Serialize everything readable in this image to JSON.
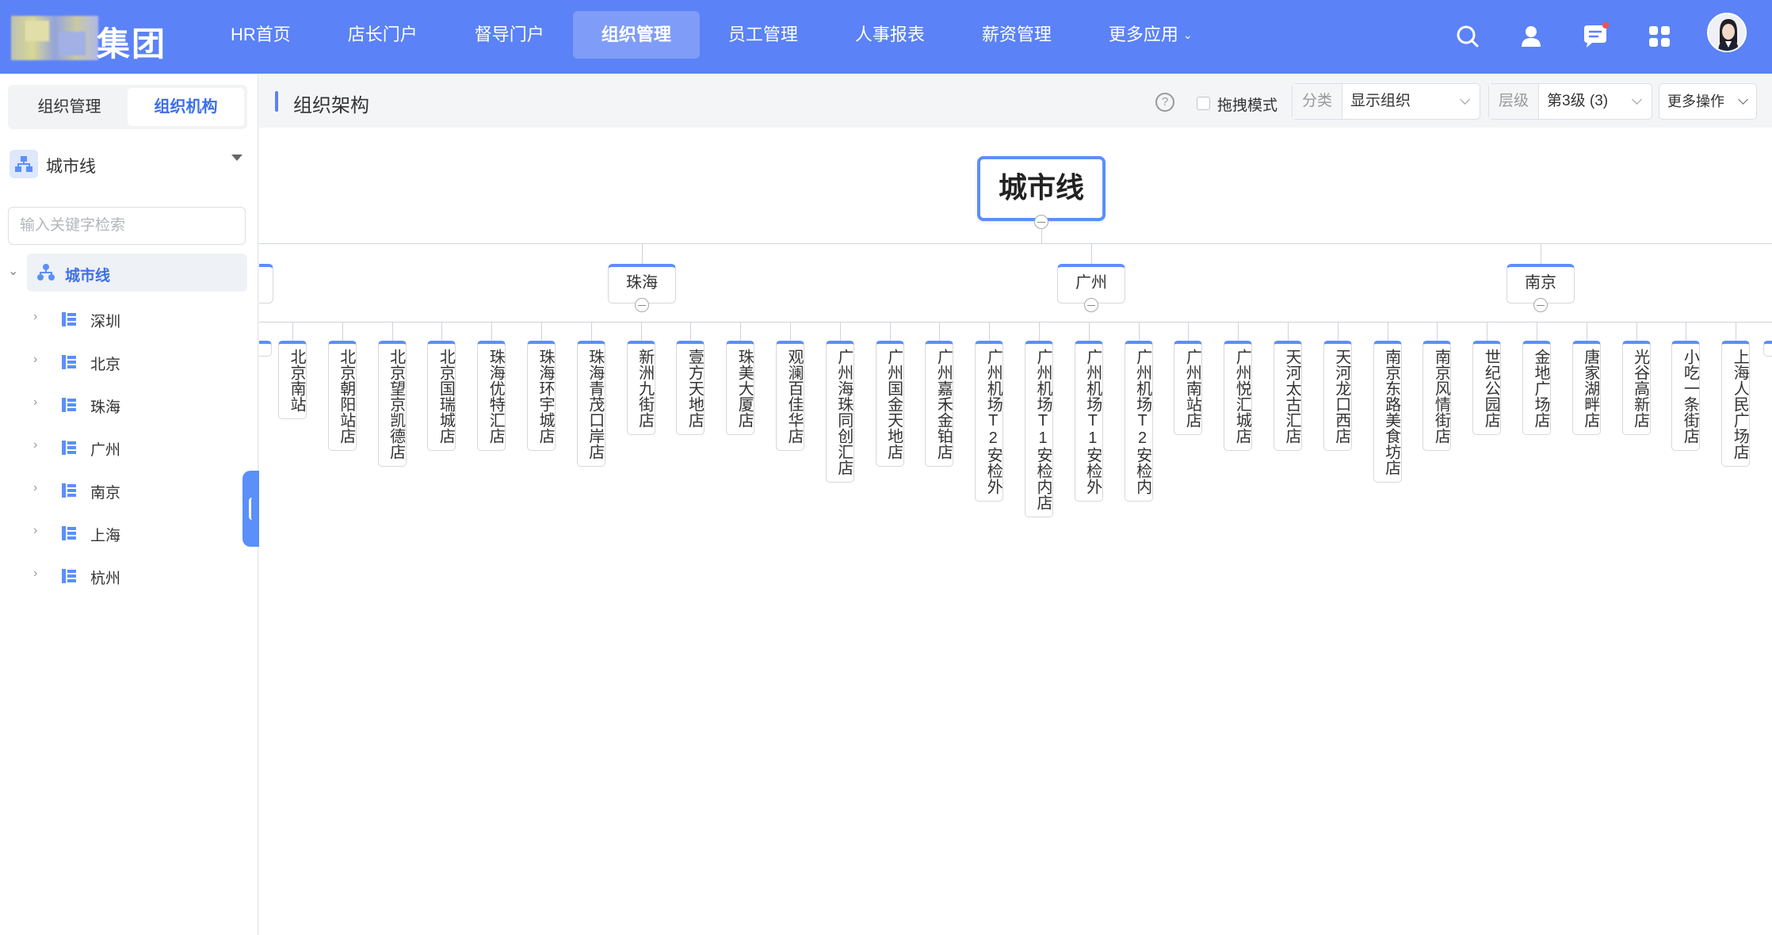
{
  "header": {
    "logo_text": "集团",
    "nav": [
      {
        "label": "HR首页",
        "active": false
      },
      {
        "label": "店长门户",
        "active": false
      },
      {
        "label": "督导门户",
        "active": false
      },
      {
        "label": "组织管理",
        "active": true
      },
      {
        "label": "员工管理",
        "active": false
      },
      {
        "label": "人事报表",
        "active": false
      },
      {
        "label": "薪资管理",
        "active": false
      },
      {
        "label": "更多应用",
        "active": false,
        "has_dropdown": true
      }
    ],
    "icons": [
      "search-icon",
      "user-icon",
      "message-icon",
      "apps-icon"
    ],
    "accent_color": "#5b82f6"
  },
  "sidebar": {
    "tabs": [
      {
        "label": "组织管理",
        "active": false
      },
      {
        "label": "组织机构",
        "active": true
      }
    ],
    "org_select": "城市线",
    "search_placeholder": "输入关键字检索",
    "tree_root": "城市线",
    "tree_items": [
      "深圳",
      "北京",
      "珠海",
      "广州",
      "南京",
      "上海",
      "杭州"
    ]
  },
  "main": {
    "title": "组织架构",
    "help": "?",
    "drag_mode_label": "拖拽模式",
    "category_label": "分类",
    "category_value": "显示组织",
    "level_label": "层级",
    "level_value": "第3级 (3)",
    "more_ops": "更多操作"
  },
  "org_chart": {
    "root": "城市线",
    "cities": [
      "珠海",
      "广州",
      "南京"
    ],
    "stores": [
      "北京南站",
      "北京朝阳站店",
      "北京望京凯德店",
      "北京国瑞城店",
      "珠海优特汇店",
      "珠海环宇城店",
      "珠海青茂口岸店",
      "新洲九街店",
      "壹方天地店",
      "珠美大厦店",
      "观澜百佳华店",
      "广州海珠同创汇店",
      "广州国金天地店",
      "广州嘉禾金铂店",
      "广州机场T2安检外",
      "广州机场T1安检内店",
      "广州机场T1安检外",
      "广州机场T2安检内",
      "广州南站店",
      "广州悦汇城店",
      "天河太古汇店",
      "天河龙口西店",
      "南京东路美食坊店",
      "南京风情街店",
      "世纪公园店",
      "金地广场店",
      "唐家湖畔店",
      "光谷高新店",
      "小吃一条街店",
      "上海人民广场店"
    ]
  }
}
